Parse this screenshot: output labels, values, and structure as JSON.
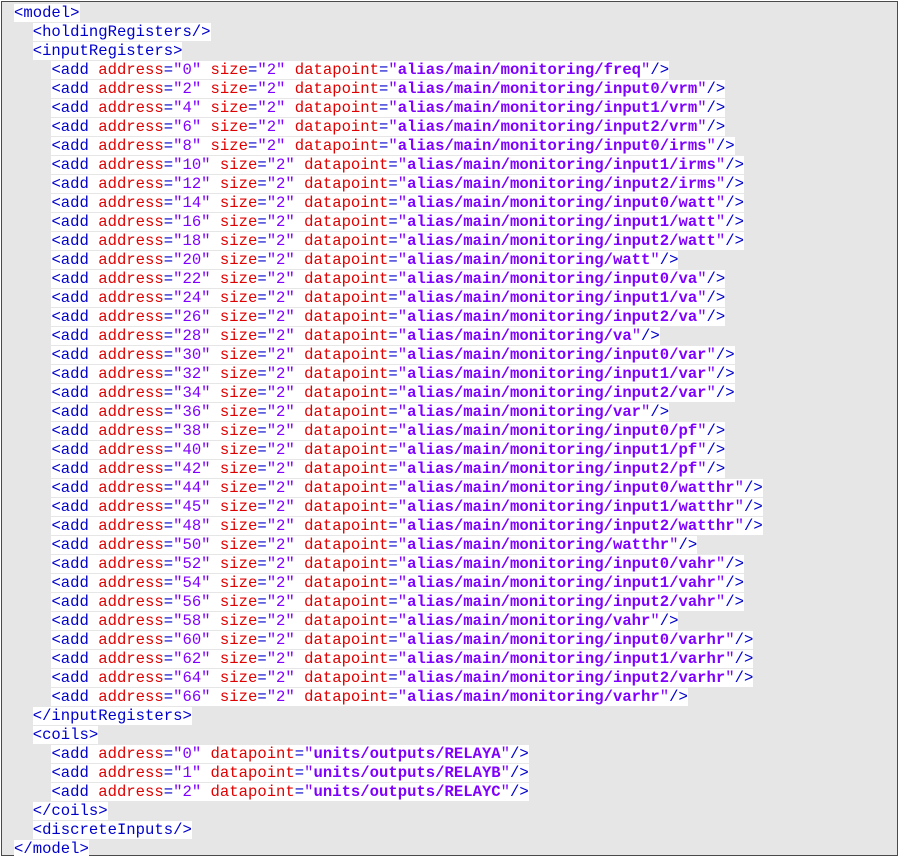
{
  "lines": [
    {
      "indent": 0,
      "type": "raw",
      "text": "<model>"
    },
    {
      "indent": 1,
      "type": "raw",
      "text": "<holdingRegisters/>"
    },
    {
      "indent": 1,
      "type": "raw",
      "text": "<inputRegisters>"
    },
    {
      "indent": 2,
      "type": "add",
      "address": "0",
      "size": "2",
      "datapoint": "alias/main/monitoring/freq"
    },
    {
      "indent": 2,
      "type": "add",
      "address": "2",
      "size": "2",
      "datapoint": "alias/main/monitoring/input0/vrm"
    },
    {
      "indent": 2,
      "type": "add",
      "address": "4",
      "size": "2",
      "datapoint": "alias/main/monitoring/input1/vrm"
    },
    {
      "indent": 2,
      "type": "add",
      "address": "6",
      "size": "2",
      "datapoint": "alias/main/monitoring/input2/vrm"
    },
    {
      "indent": 2,
      "type": "add",
      "address": "8",
      "size": "2",
      "datapoint": "alias/main/monitoring/input0/irms"
    },
    {
      "indent": 2,
      "type": "add",
      "address": "10",
      "size": "2",
      "datapoint": "alias/main/monitoring/input1/irms"
    },
    {
      "indent": 2,
      "type": "add",
      "address": "12",
      "size": "2",
      "datapoint": "alias/main/monitoring/input2/irms"
    },
    {
      "indent": 2,
      "type": "add",
      "address": "14",
      "size": "2",
      "datapoint": "alias/main/monitoring/input0/watt"
    },
    {
      "indent": 2,
      "type": "add",
      "address": "16",
      "size": "2",
      "datapoint": "alias/main/monitoring/input1/watt"
    },
    {
      "indent": 2,
      "type": "add",
      "address": "18",
      "size": "2",
      "datapoint": "alias/main/monitoring/input2/watt"
    },
    {
      "indent": 2,
      "type": "add",
      "address": "20",
      "size": "2",
      "datapoint": "alias/main/monitoring/watt"
    },
    {
      "indent": 2,
      "type": "add",
      "address": "22",
      "size": "2",
      "datapoint": "alias/main/monitoring/input0/va"
    },
    {
      "indent": 2,
      "type": "add",
      "address": "24",
      "size": "2",
      "datapoint": "alias/main/monitoring/input1/va"
    },
    {
      "indent": 2,
      "type": "add",
      "address": "26",
      "size": "2",
      "datapoint": "alias/main/monitoring/input2/va"
    },
    {
      "indent": 2,
      "type": "add",
      "address": "28",
      "size": "2",
      "datapoint": "alias/main/monitoring/va"
    },
    {
      "indent": 2,
      "type": "add",
      "address": "30",
      "size": "2",
      "datapoint": "alias/main/monitoring/input0/var"
    },
    {
      "indent": 2,
      "type": "add",
      "address": "32",
      "size": "2",
      "datapoint": "alias/main/monitoring/input1/var"
    },
    {
      "indent": 2,
      "type": "add",
      "address": "34",
      "size": "2",
      "datapoint": "alias/main/monitoring/input2/var"
    },
    {
      "indent": 2,
      "type": "add",
      "address": "36",
      "size": "2",
      "datapoint": "alias/main/monitoring/var"
    },
    {
      "indent": 2,
      "type": "add",
      "address": "38",
      "size": "2",
      "datapoint": "alias/main/monitoring/input0/pf"
    },
    {
      "indent": 2,
      "type": "add",
      "address": "40",
      "size": "2",
      "datapoint": "alias/main/monitoring/input1/pf"
    },
    {
      "indent": 2,
      "type": "add",
      "address": "42",
      "size": "2",
      "datapoint": "alias/main/monitoring/input2/pf"
    },
    {
      "indent": 2,
      "type": "add",
      "address": "44",
      "size": "2",
      "datapoint": "alias/main/monitoring/input0/watthr"
    },
    {
      "indent": 2,
      "type": "add",
      "address": "45",
      "size": "2",
      "datapoint": "alias/main/monitoring/input1/watthr"
    },
    {
      "indent": 2,
      "type": "add",
      "address": "48",
      "size": "2",
      "datapoint": "alias/main/monitoring/input2/watthr"
    },
    {
      "indent": 2,
      "type": "add",
      "address": "50",
      "size": "2",
      "datapoint": "alias/main/monitoring/watthr"
    },
    {
      "indent": 2,
      "type": "add",
      "address": "52",
      "size": "2",
      "datapoint": "alias/main/monitoring/input0/vahr"
    },
    {
      "indent": 2,
      "type": "add",
      "address": "54",
      "size": "2",
      "datapoint": "alias/main/monitoring/input1/vahr"
    },
    {
      "indent": 2,
      "type": "add",
      "address": "56",
      "size": "2",
      "datapoint": "alias/main/monitoring/input2/vahr"
    },
    {
      "indent": 2,
      "type": "add",
      "address": "58",
      "size": "2",
      "datapoint": "alias/main/monitoring/vahr"
    },
    {
      "indent": 2,
      "type": "add",
      "address": "60",
      "size": "2",
      "datapoint": "alias/main/monitoring/input0/varhr"
    },
    {
      "indent": 2,
      "type": "add",
      "address": "62",
      "size": "2",
      "datapoint": "alias/main/monitoring/input1/varhr"
    },
    {
      "indent": 2,
      "type": "add",
      "address": "64",
      "size": "2",
      "datapoint": "alias/main/monitoring/input2/varhr"
    },
    {
      "indent": 2,
      "type": "add",
      "address": "66",
      "size": "2",
      "datapoint": "alias/main/monitoring/varhr"
    },
    {
      "indent": 1,
      "type": "raw",
      "text": "</inputRegisters>"
    },
    {
      "indent": 1,
      "type": "raw",
      "text": "<coils>"
    },
    {
      "indent": 2,
      "type": "add",
      "address": "0",
      "datapoint": "units/outputs/RELAYA"
    },
    {
      "indent": 2,
      "type": "add",
      "address": "1",
      "datapoint": "units/outputs/RELAYB"
    },
    {
      "indent": 2,
      "type": "add",
      "address": "2",
      "datapoint": "units/outputs/RELAYC"
    },
    {
      "indent": 1,
      "type": "raw",
      "text": "</coils>"
    },
    {
      "indent": 1,
      "type": "raw",
      "text": "<discreteInputs/>"
    },
    {
      "indent": 0,
      "type": "raw",
      "text": "</model>"
    }
  ]
}
